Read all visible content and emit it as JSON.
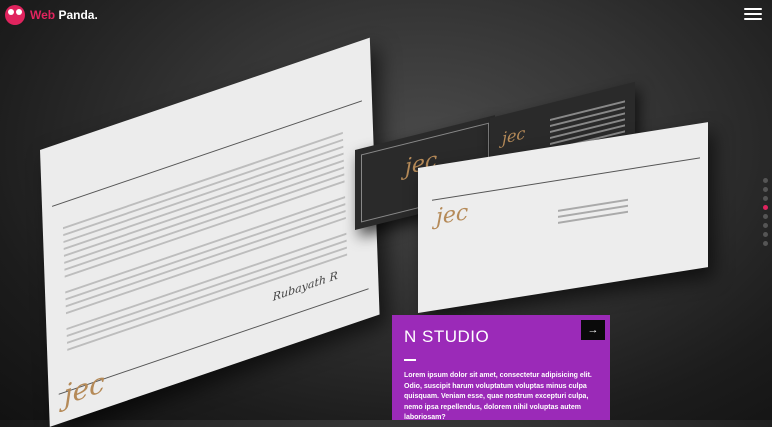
{
  "brand": {
    "name_part1": "Web",
    "name_part2": "Panda.",
    "accent": "#e0245e",
    "panel_color": "#9b2ab8"
  },
  "menu_icon": "hamburger-icon",
  "slides": {
    "count": 8,
    "active": 3
  },
  "panel": {
    "title": "N STUDIO",
    "text": "Lorem ipsum dolor sit amet, consectetur adipisicing elit. Odio, suscipit harum voluptatum voluptas minus culpa quisquam. Veniam esse, quae nostrum excepturi culpa, nemo ipsa repellendus, dolorem nihil voluptas autem laboriosam?",
    "arrow": "→"
  },
  "mockup": {
    "logo": "jec",
    "signature": "Rubayath R",
    "card_logo": "jec"
  }
}
